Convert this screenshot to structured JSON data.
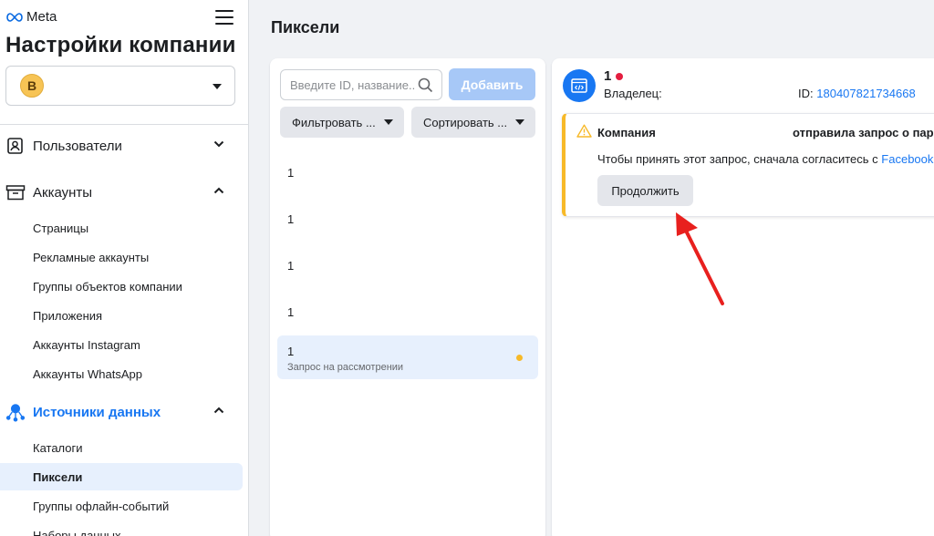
{
  "sidebar": {
    "brand": "Meta",
    "company_title": "Настройки компании",
    "company_initial": "B",
    "sections": {
      "users": "Пользователи",
      "accounts": "Аккаунты",
      "data_sources": "Источники данных"
    },
    "accounts_items": [
      "Страницы",
      "Рекламные аккаунты",
      "Группы объектов компании",
      "Приложения",
      "Аккаунты Instagram",
      "Аккаунты WhatsApp"
    ],
    "data_sources_items": [
      "Каталоги",
      "Пиксели",
      "Группы офлайн-событий",
      "Наборы данных"
    ],
    "accent_color": "#1877f2"
  },
  "main": {
    "page_title": "Пиксели",
    "search_placeholder": "Введите ID, название...",
    "add_button": "Добавить",
    "filter_label": "Фильтровать ...",
    "sort_label": "Сортировать ...",
    "list": [
      {
        "name": "1",
        "status": ""
      },
      {
        "name": "1",
        "status": ""
      },
      {
        "name": "1",
        "status": ""
      },
      {
        "name": "1",
        "status": ""
      },
      {
        "name": "1",
        "status": "Запрос на рассмотрении"
      }
    ]
  },
  "detail": {
    "pixel_name": "1",
    "owner_label": "Владелец:",
    "id_label": "ID:",
    "id_value": "180407821734668",
    "alert": {
      "title": "Компания",
      "title_right": "отправила запрос о пар",
      "body": "Чтобы принять этот запрос, сначала согласитесь с",
      "body_link": "Facebook",
      "button": "Продолжить"
    }
  }
}
